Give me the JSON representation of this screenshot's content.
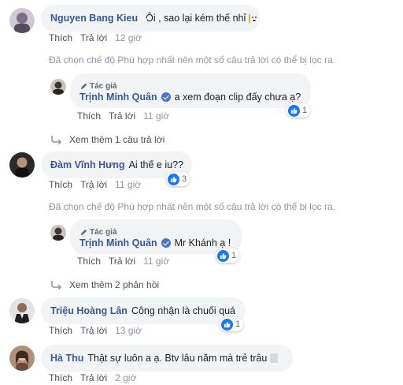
{
  "labels": {
    "like": "Thích",
    "reply": "Trả lời",
    "author_tag": "Tác giả",
    "filter_note": "Đã chọn chế độ Phù hợp nhất nên một số câu trả lời có thể bị lọc ra."
  },
  "comments": [
    {
      "name": "Nguyen Bang Kieu",
      "verified": true,
      "text": "Ôi , sao lại kém thế nhỉ",
      "emoji": "slightly-frowning-face-icon",
      "time": "12 giờ"
    },
    {
      "name": "Trịnh Minh Quân",
      "verified": true,
      "author": true,
      "text": "a xem đoạn clip đấy chưa ạ?",
      "likes": "1",
      "time": "11 giờ"
    },
    {
      "name": "Đàm Vĩnh Hưng",
      "text": "Ai thế e iu??",
      "likes": "3",
      "time": "11 giờ"
    },
    {
      "name": "Trịnh Minh Quân",
      "verified": true,
      "author": true,
      "text": "Mr Khánh ạ !",
      "likes": "1",
      "time": "11 giờ"
    },
    {
      "name": "Triệu Hoàng Lân",
      "text": "Công nhận là chuối quá",
      "likes": "1",
      "time": "13 giờ"
    },
    {
      "name": "Hà Thu",
      "text": "Thật sự luôn a ạ. Btv lâu năm mà trẻ trâu",
      "time": "2 giờ"
    }
  ],
  "more_replies": [
    {
      "label": "Xem thêm 1 câu trả lời"
    },
    {
      "label": "Xem thêm 2 phản hồi"
    }
  ],
  "colors": {
    "name": "#385898",
    "bubble": "#f2f3f5",
    "like": "#1877f2"
  }
}
